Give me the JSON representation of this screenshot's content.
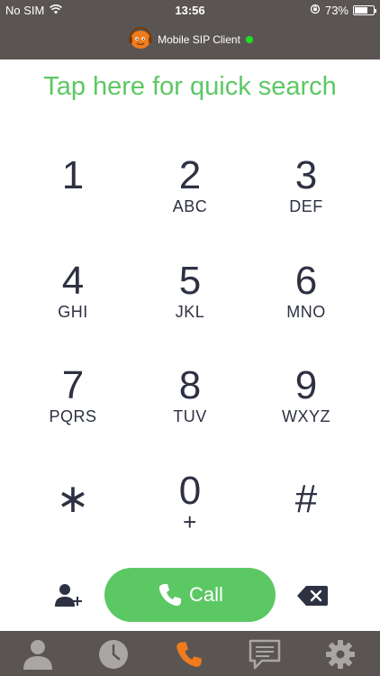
{
  "status_bar": {
    "carrier": "No SIM",
    "time": "13:56",
    "battery": "73%",
    "battery_level": 0.73
  },
  "header": {
    "app_name": "Mobile SIP Client",
    "online_color": "#1ee01e"
  },
  "quick_search": {
    "label": "Tap here for quick search",
    "color": "#5cc864"
  },
  "keypad": [
    {
      "digit": "1",
      "letters": ""
    },
    {
      "digit": "2",
      "letters": "ABC"
    },
    {
      "digit": "3",
      "letters": "DEF"
    },
    {
      "digit": "4",
      "letters": "GHI"
    },
    {
      "digit": "5",
      "letters": "JKL"
    },
    {
      "digit": "6",
      "letters": "MNO"
    },
    {
      "digit": "7",
      "letters": "PQRS"
    },
    {
      "digit": "8",
      "letters": "TUV"
    },
    {
      "digit": "9",
      "letters": "WXYZ"
    },
    {
      "digit": "∗",
      "letters": ""
    },
    {
      "digit": "0",
      "letters": "+"
    },
    {
      "digit": "#",
      "letters": ""
    }
  ],
  "actions": {
    "call_label": "Call",
    "call_color": "#5cc864",
    "add_contact_icon": "add-contact-icon",
    "backspace_icon": "backspace-icon"
  },
  "tabs": [
    {
      "icon": "contacts-icon",
      "active": false
    },
    {
      "icon": "recents-clock-icon",
      "active": false
    },
    {
      "icon": "phone-icon",
      "active": true
    },
    {
      "icon": "messages-icon",
      "active": false
    },
    {
      "icon": "settings-gear-icon",
      "active": false
    }
  ],
  "colors": {
    "bar_background": "#5a5553",
    "active_tab": "#f07c1e",
    "inactive_tab": "#a9a6a4"
  }
}
